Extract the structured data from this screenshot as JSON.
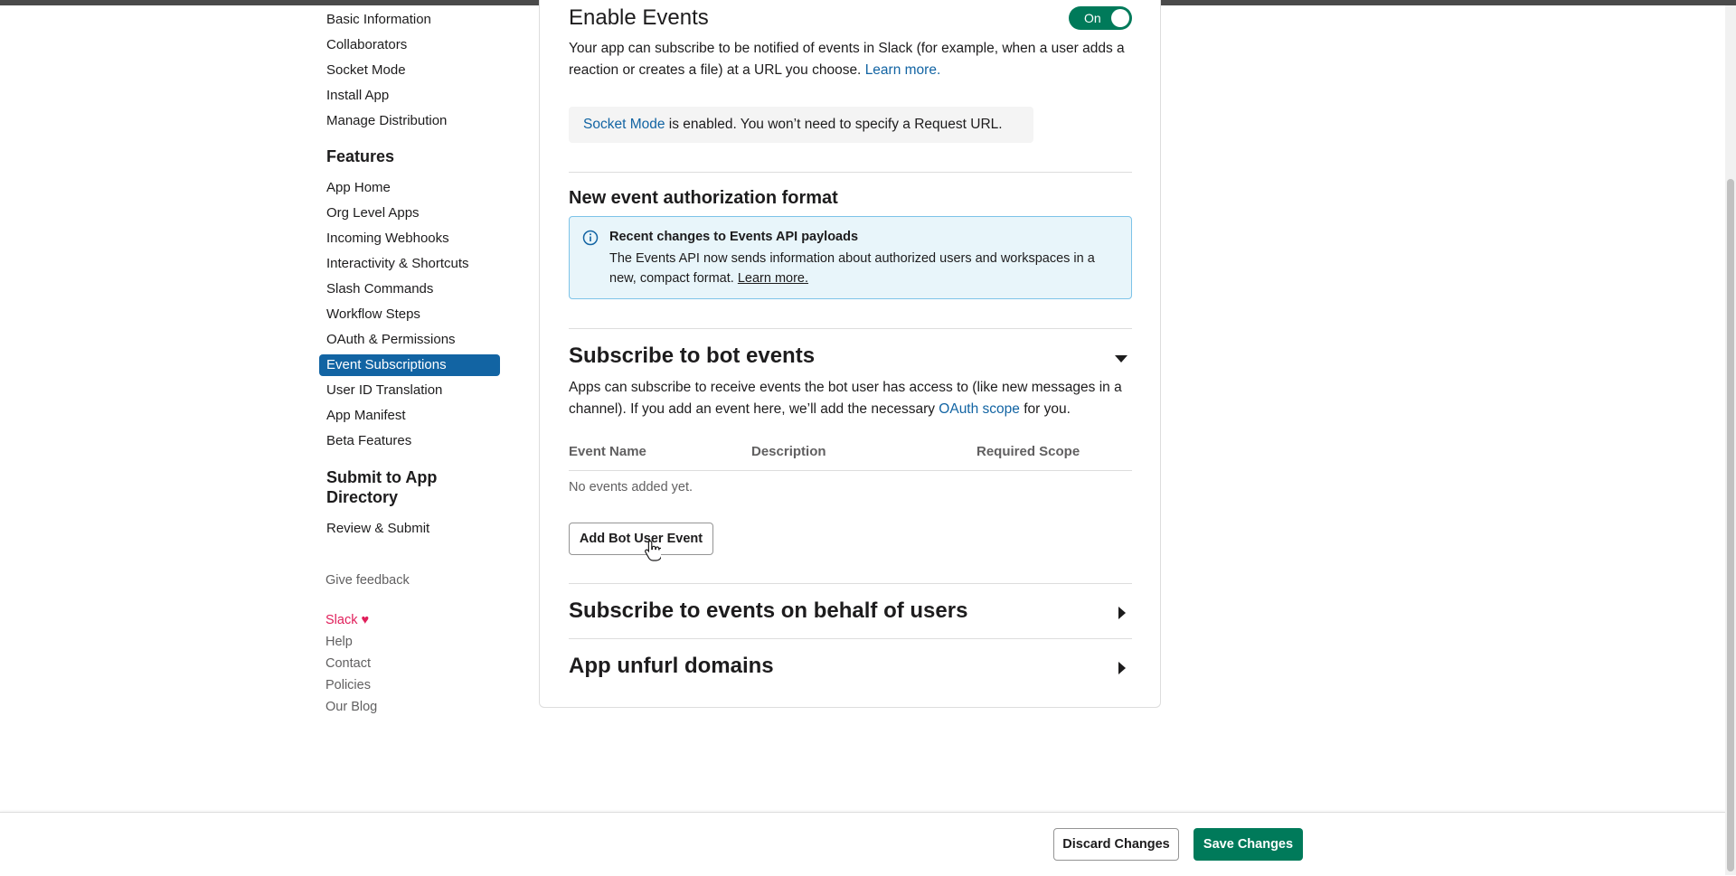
{
  "sidebar": {
    "settings_items": [
      {
        "label": "Basic Information"
      },
      {
        "label": "Collaborators"
      },
      {
        "label": "Socket Mode"
      },
      {
        "label": "Install App"
      },
      {
        "label": "Manage Distribution"
      }
    ],
    "features_heading": "Features",
    "feature_items": [
      {
        "label": "App Home"
      },
      {
        "label": "Org Level Apps"
      },
      {
        "label": "Incoming Webhooks"
      },
      {
        "label": "Interactivity & Shortcuts"
      },
      {
        "label": "Slash Commands"
      },
      {
        "label": "Workflow Steps"
      },
      {
        "label": "OAuth & Permissions"
      },
      {
        "label": "Event Subscriptions",
        "active": true
      },
      {
        "label": "User ID Translation"
      },
      {
        "label": "App Manifest"
      },
      {
        "label": "Beta Features"
      }
    ],
    "submit_heading_line1": "Submit to App",
    "submit_heading_line2": "Directory",
    "submit_items": [
      {
        "label": "Review & Submit"
      }
    ],
    "feedback": "Give feedback",
    "footer": {
      "slack": "Slack",
      "slack_heart": "♥",
      "help": "Help",
      "contact": "Contact",
      "policies": "Policies",
      "blog": "Our Blog"
    }
  },
  "main": {
    "enable_events": {
      "title": "Enable Events",
      "toggle_label": "On",
      "toggle_state": "on",
      "desc_line1": "Your app can subscribe to be notified of events in Slack (for example, when a user adds a",
      "desc_line2": "reaction or creates a file) at a URL you choose.",
      "learn_more": "Learn more.",
      "socket_link": "Socket Mode",
      "socket_text": " is enabled. You won’t need to specify a Request URL."
    },
    "auth_format": {
      "title": "New event authorization format",
      "info_title": "Recent changes to Events API payloads",
      "info_line1": "The Events API now sends information about authorized users and workspaces in a",
      "info_line2": "new, compact format.",
      "info_link": "Learn more."
    },
    "bot_events": {
      "title": "Subscribe to bot events",
      "desc_line1": "Apps can subscribe to receive events the bot user has access to (like new messages in a",
      "desc_line2_a": "channel). If you add an event here, we’ll add the necessary",
      "desc_link": "OAuth scope",
      "desc_line2_b": "for you.",
      "columns": [
        "Event Name",
        "Description",
        "Required Scope"
      ],
      "empty_text": "No events added yet.",
      "add_button": "Add Bot User Event"
    },
    "user_events": {
      "title": "Subscribe to events on behalf of users"
    },
    "unfurl": {
      "title": "App unfurl domains"
    }
  },
  "footer_bar": {
    "discard": "Discard Changes",
    "save": "Save Changes"
  },
  "colors": {
    "accent": "#1264a3",
    "primary_green": "#007a5a",
    "info_bg": "#e8f5fa",
    "slack_pink": "#e01e5a"
  }
}
